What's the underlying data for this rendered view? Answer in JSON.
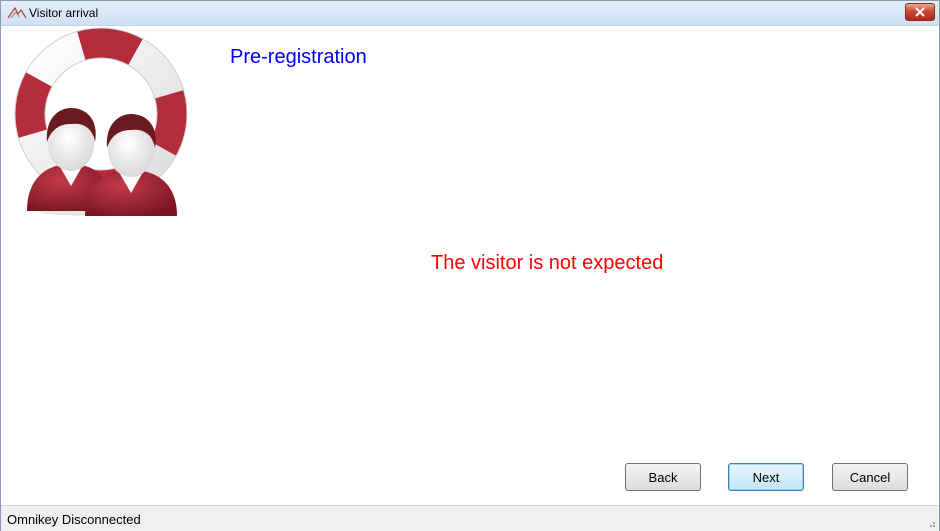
{
  "window": {
    "title": "Visitor arrival"
  },
  "main": {
    "heading": "Pre-registration",
    "message": "The visitor is not expected",
    "heading_color": "#0000ff",
    "message_color": "#ff0000"
  },
  "buttons": {
    "back": "Back",
    "next": "Next",
    "cancel": "Cancel"
  },
  "statusbar": {
    "text": "Omnikey Disconnected"
  },
  "icons": {
    "app": "visitor-app-icon",
    "close": "close-icon",
    "logo": "visitors-lifebuoy-logo",
    "grip": "resize-grip-icon"
  }
}
